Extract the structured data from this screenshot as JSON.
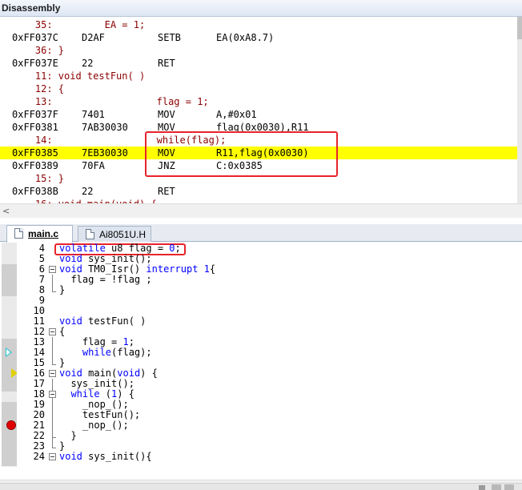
{
  "disassembly": {
    "title": "Disassembly",
    "lines": [
      {
        "kind": "src",
        "text": "    35:         EA = 1;"
      },
      {
        "kind": "asm",
        "addr": "0xFF037C",
        "op": "D2AF",
        "mn": "SETB",
        "arg": "EA(0xA8.7)"
      },
      {
        "kind": "src",
        "text": "    36: }"
      },
      {
        "kind": "asm",
        "addr": "0xFF037E",
        "op": "22",
        "mn": "RET",
        "arg": ""
      },
      {
        "kind": "src",
        "text": "    11: void testFun( )"
      },
      {
        "kind": "src",
        "text": "    12: {"
      },
      {
        "kind": "src",
        "text": "    13:                  flag = 1;"
      },
      {
        "kind": "asm",
        "addr": "0xFF037F",
        "op": "7401",
        "mn": "MOV",
        "arg": "A,#0x01"
      },
      {
        "kind": "asm",
        "addr": "0xFF0381",
        "op": "7AB30030",
        "mn": "MOV",
        "arg": "flag(0x0030),R11"
      },
      {
        "kind": "src",
        "text": "    14:                  while(flag);"
      },
      {
        "kind": "asm",
        "addr": "0xFF0385",
        "op": "7EB30030",
        "mn": "MOV",
        "arg": "R11,flag(0x0030)",
        "highlight": true
      },
      {
        "kind": "asm",
        "addr": "0xFF0389",
        "op": "70FA",
        "mn": "JNZ",
        "arg": "C:0x0385"
      },
      {
        "kind": "src",
        "text": "    15: }"
      },
      {
        "kind": "asm",
        "addr": "0xFF038B",
        "op": "22",
        "mn": "RET",
        "arg": ""
      },
      {
        "kind": "src",
        "text": "    16: void main(void) {"
      }
    ]
  },
  "tabs": [
    {
      "label": "main.c",
      "active": true
    },
    {
      "label": "Ai8051U.H",
      "active": false
    }
  ],
  "editor": {
    "lines": [
      {
        "n": "4",
        "code": "volatile u8 flag = 0;"
      },
      {
        "n": "5",
        "code": "void sys_init();"
      },
      {
        "n": "6",
        "code": "void TM0_Isr() interrupt 1{"
      },
      {
        "n": "7",
        "code": "  flag = !flag ;"
      },
      {
        "n": "8",
        "code": "}"
      },
      {
        "n": "9",
        "code": ""
      },
      {
        "n": "10",
        "code": ""
      },
      {
        "n": "11",
        "code": "void testFun( )"
      },
      {
        "n": "12",
        "code": "{"
      },
      {
        "n": "13",
        "code": "    flag = 1;"
      },
      {
        "n": "14",
        "code": "    while(flag);"
      },
      {
        "n": "15",
        "code": "}"
      },
      {
        "n": "16",
        "code": "void main(void) {"
      },
      {
        "n": "17",
        "code": "  sys_init();"
      },
      {
        "n": "18",
        "code": "  while (1) {"
      },
      {
        "n": "19",
        "code": "    _nop_();"
      },
      {
        "n": "20",
        "code": "    testFun();"
      },
      {
        "n": "21",
        "code": "    _nop_();"
      },
      {
        "n": "22",
        "code": "  }"
      },
      {
        "n": "23",
        "code": "}"
      },
      {
        "n": "24",
        "code": "void sys_init(){"
      }
    ]
  },
  "colors": {
    "highlight": "#ffff00",
    "annotation": "#e8232a",
    "source_line": "#8b0000",
    "keyword": "#0000ff"
  },
  "markers": {
    "current_line_icon": "cyan-arrow-icon",
    "caller_line_icon": "yellow-arrow-icon",
    "breakpoint_icon": "breakpoint-icon"
  }
}
